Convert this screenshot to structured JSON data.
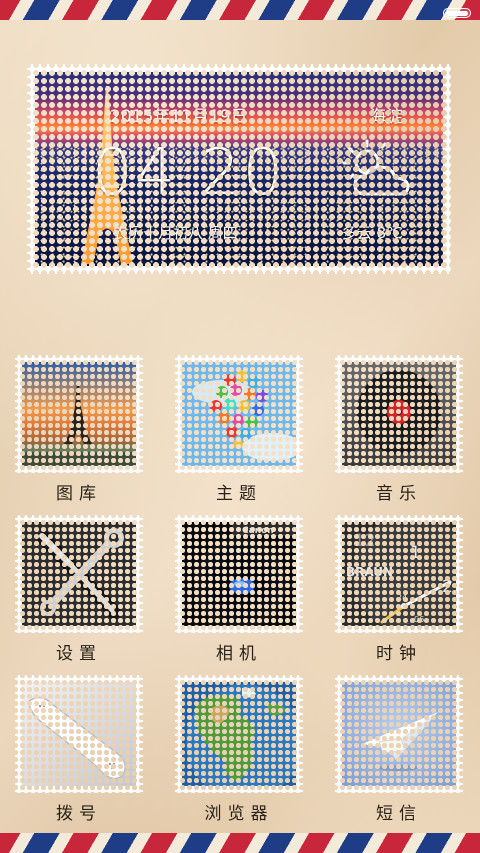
{
  "status_bar": {
    "battery_level": 1.0
  },
  "widget": {
    "date": "2015年11月19日",
    "location": "海淀",
    "time": "04 20",
    "lunar_date": "农历十月初八 周四",
    "weather": "多云   8℃",
    "weather_icon": "partly-cloudy-icon"
  },
  "apps": [
    {
      "label": "图库",
      "icon": "gallery-icon"
    },
    {
      "label": "主题",
      "icon": "theme-icon"
    },
    {
      "label": "音乐",
      "icon": "music-icon"
    },
    {
      "label": "设置",
      "icon": "settings-icon"
    },
    {
      "label": "相机",
      "icon": "camera-icon"
    },
    {
      "label": "时钟",
      "icon": "clock-icon"
    },
    {
      "label": "拨号",
      "icon": "phone-icon"
    },
    {
      "label": "浏览器",
      "icon": "browser-icon"
    },
    {
      "label": "短信",
      "icon": "messages-icon"
    }
  ],
  "camera_brand": "Canon",
  "clock_brand": "BRAUN",
  "clock_digits": [
    "12",
    "1",
    "2",
    "24",
    "06"
  ],
  "colors": {
    "airmail_red": "#c8263a",
    "airmail_blue": "#1f3d87",
    "paper": "#e9d7bf"
  }
}
